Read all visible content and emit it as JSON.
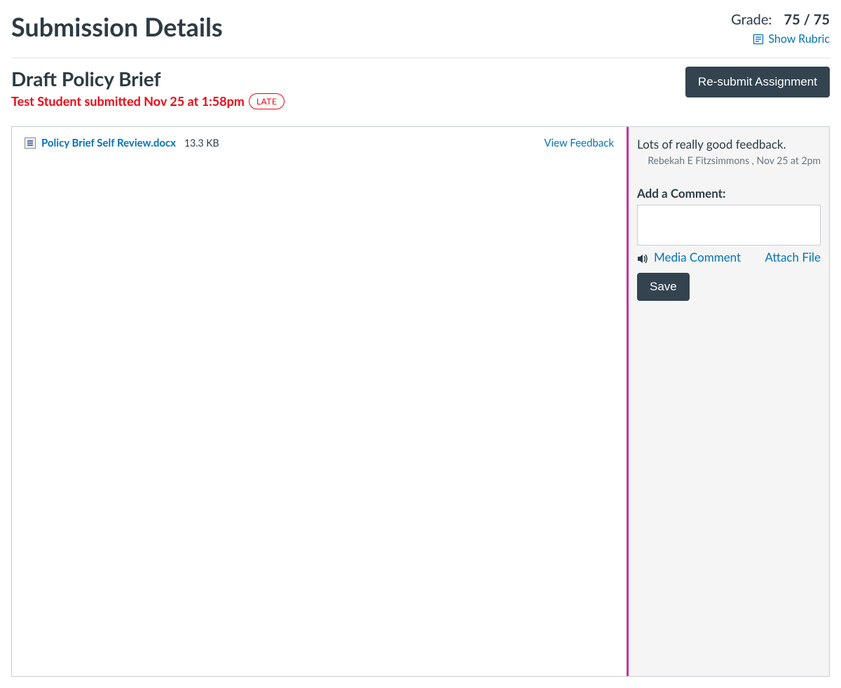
{
  "header": {
    "page_title": "Submission Details",
    "grade_label": "Grade:",
    "grade_value": "75 / 75",
    "show_rubric": "Show Rubric"
  },
  "assignment": {
    "title": "Draft Policy Brief",
    "submitted_text": "Test Student submitted Nov 25 at 1:58pm",
    "late_badge": "LATE",
    "resubmit_label": "Re-submit Assignment"
  },
  "file": {
    "name": "Policy Brief Self Review.docx",
    "size": "13.3 KB",
    "view_feedback": "View Feedback"
  },
  "feedback": {
    "comment_text": "Lots of really good feedback.",
    "comment_author": "Rebekah E Fitzsimmons",
    "comment_time": "Nov 25 at 2pm",
    "add_comment_label": "Add a Comment:",
    "media_comment": "Media Comment",
    "attach_file": "Attach File",
    "save_label": "Save"
  }
}
